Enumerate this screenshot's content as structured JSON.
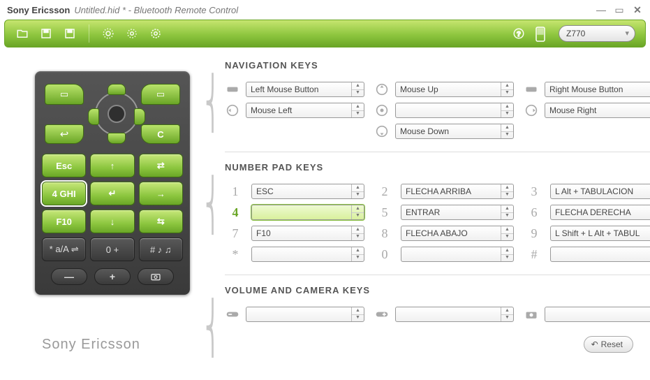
{
  "titlebar": {
    "brand": "Sony Ericsson",
    "filename": "Untitled.hid * - Bluetooth Remote Control"
  },
  "toolbar": {
    "device": "Z770"
  },
  "sections": {
    "nav_title": "NAVIGATION KEYS",
    "num_title": "NUMBER PAD KEYS",
    "vol_title": "VOLUME AND CAMERA KEYS"
  },
  "nav": {
    "left_soft": "Left Mouse Button",
    "up": "Mouse Up",
    "right_soft": "Right Mouse Button",
    "left": "Mouse Left",
    "center": "",
    "right": "Mouse Right",
    "down": "Mouse Down"
  },
  "num": {
    "k1": "ESC",
    "k2": "FLECHA ARRIBA",
    "k3": "L Alt + TABULACION",
    "k4": "",
    "k5": "ENTRAR",
    "k6": "FLECHA DERECHA",
    "k7": "F10",
    "k8": "FLECHA ABAJO",
    "k9": "L Shift + L Alt + TABUL",
    "kstar": "",
    "k0": "",
    "khash": ""
  },
  "num_labels": {
    "k1": "1",
    "k2": "2",
    "k3": "3",
    "k4": "4",
    "k5": "5",
    "k6": "6",
    "k7": "7",
    "k8": "8",
    "k9": "9",
    "kstar": "*",
    "k0": "0",
    "khash": "#"
  },
  "vol": {
    "minus": "",
    "plus": "",
    "camera": ""
  },
  "remote": {
    "keys": [
      "Esc",
      "↑",
      "⇄",
      "4  GHI",
      "↵",
      "→",
      "F10",
      "↓",
      "⇆",
      "*  a/A ⇌",
      "0  +",
      "#  ♪ ♫"
    ],
    "back": "↩",
    "c": "C",
    "minus": "—",
    "plus": "+"
  },
  "footer": {
    "brand": "Sony Ericsson",
    "reset": "Reset"
  }
}
